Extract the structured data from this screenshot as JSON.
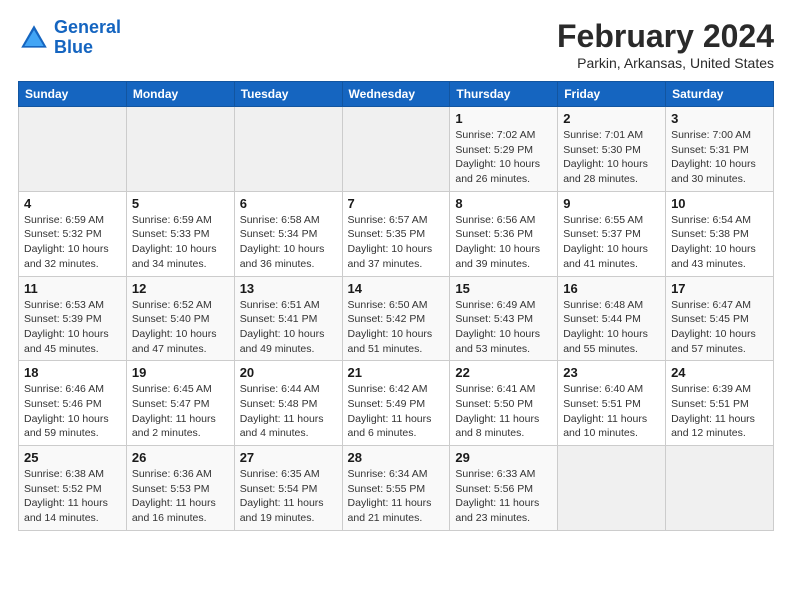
{
  "header": {
    "logo_line1": "General",
    "logo_line2": "Blue",
    "title": "February 2024",
    "subtitle": "Parkin, Arkansas, United States"
  },
  "days_of_week": [
    "Sunday",
    "Monday",
    "Tuesday",
    "Wednesday",
    "Thursday",
    "Friday",
    "Saturday"
  ],
  "weeks": [
    [
      {
        "day": "",
        "info": ""
      },
      {
        "day": "",
        "info": ""
      },
      {
        "day": "",
        "info": ""
      },
      {
        "day": "",
        "info": ""
      },
      {
        "day": "1",
        "info": "Sunrise: 7:02 AM\nSunset: 5:29 PM\nDaylight: 10 hours\nand 26 minutes."
      },
      {
        "day": "2",
        "info": "Sunrise: 7:01 AM\nSunset: 5:30 PM\nDaylight: 10 hours\nand 28 minutes."
      },
      {
        "day": "3",
        "info": "Sunrise: 7:00 AM\nSunset: 5:31 PM\nDaylight: 10 hours\nand 30 minutes."
      }
    ],
    [
      {
        "day": "4",
        "info": "Sunrise: 6:59 AM\nSunset: 5:32 PM\nDaylight: 10 hours\nand 32 minutes."
      },
      {
        "day": "5",
        "info": "Sunrise: 6:59 AM\nSunset: 5:33 PM\nDaylight: 10 hours\nand 34 minutes."
      },
      {
        "day": "6",
        "info": "Sunrise: 6:58 AM\nSunset: 5:34 PM\nDaylight: 10 hours\nand 36 minutes."
      },
      {
        "day": "7",
        "info": "Sunrise: 6:57 AM\nSunset: 5:35 PM\nDaylight: 10 hours\nand 37 minutes."
      },
      {
        "day": "8",
        "info": "Sunrise: 6:56 AM\nSunset: 5:36 PM\nDaylight: 10 hours\nand 39 minutes."
      },
      {
        "day": "9",
        "info": "Sunrise: 6:55 AM\nSunset: 5:37 PM\nDaylight: 10 hours\nand 41 minutes."
      },
      {
        "day": "10",
        "info": "Sunrise: 6:54 AM\nSunset: 5:38 PM\nDaylight: 10 hours\nand 43 minutes."
      }
    ],
    [
      {
        "day": "11",
        "info": "Sunrise: 6:53 AM\nSunset: 5:39 PM\nDaylight: 10 hours\nand 45 minutes."
      },
      {
        "day": "12",
        "info": "Sunrise: 6:52 AM\nSunset: 5:40 PM\nDaylight: 10 hours\nand 47 minutes."
      },
      {
        "day": "13",
        "info": "Sunrise: 6:51 AM\nSunset: 5:41 PM\nDaylight: 10 hours\nand 49 minutes."
      },
      {
        "day": "14",
        "info": "Sunrise: 6:50 AM\nSunset: 5:42 PM\nDaylight: 10 hours\nand 51 minutes."
      },
      {
        "day": "15",
        "info": "Sunrise: 6:49 AM\nSunset: 5:43 PM\nDaylight: 10 hours\nand 53 minutes."
      },
      {
        "day": "16",
        "info": "Sunrise: 6:48 AM\nSunset: 5:44 PM\nDaylight: 10 hours\nand 55 minutes."
      },
      {
        "day": "17",
        "info": "Sunrise: 6:47 AM\nSunset: 5:45 PM\nDaylight: 10 hours\nand 57 minutes."
      }
    ],
    [
      {
        "day": "18",
        "info": "Sunrise: 6:46 AM\nSunset: 5:46 PM\nDaylight: 10 hours\nand 59 minutes."
      },
      {
        "day": "19",
        "info": "Sunrise: 6:45 AM\nSunset: 5:47 PM\nDaylight: 11 hours\nand 2 minutes."
      },
      {
        "day": "20",
        "info": "Sunrise: 6:44 AM\nSunset: 5:48 PM\nDaylight: 11 hours\nand 4 minutes."
      },
      {
        "day": "21",
        "info": "Sunrise: 6:42 AM\nSunset: 5:49 PM\nDaylight: 11 hours\nand 6 minutes."
      },
      {
        "day": "22",
        "info": "Sunrise: 6:41 AM\nSunset: 5:50 PM\nDaylight: 11 hours\nand 8 minutes."
      },
      {
        "day": "23",
        "info": "Sunrise: 6:40 AM\nSunset: 5:51 PM\nDaylight: 11 hours\nand 10 minutes."
      },
      {
        "day": "24",
        "info": "Sunrise: 6:39 AM\nSunset: 5:51 PM\nDaylight: 11 hours\nand 12 minutes."
      }
    ],
    [
      {
        "day": "25",
        "info": "Sunrise: 6:38 AM\nSunset: 5:52 PM\nDaylight: 11 hours\nand 14 minutes."
      },
      {
        "day": "26",
        "info": "Sunrise: 6:36 AM\nSunset: 5:53 PM\nDaylight: 11 hours\nand 16 minutes."
      },
      {
        "day": "27",
        "info": "Sunrise: 6:35 AM\nSunset: 5:54 PM\nDaylight: 11 hours\nand 19 minutes."
      },
      {
        "day": "28",
        "info": "Sunrise: 6:34 AM\nSunset: 5:55 PM\nDaylight: 11 hours\nand 21 minutes."
      },
      {
        "day": "29",
        "info": "Sunrise: 6:33 AM\nSunset: 5:56 PM\nDaylight: 11 hours\nand 23 minutes."
      },
      {
        "day": "",
        "info": ""
      },
      {
        "day": "",
        "info": ""
      }
    ]
  ]
}
